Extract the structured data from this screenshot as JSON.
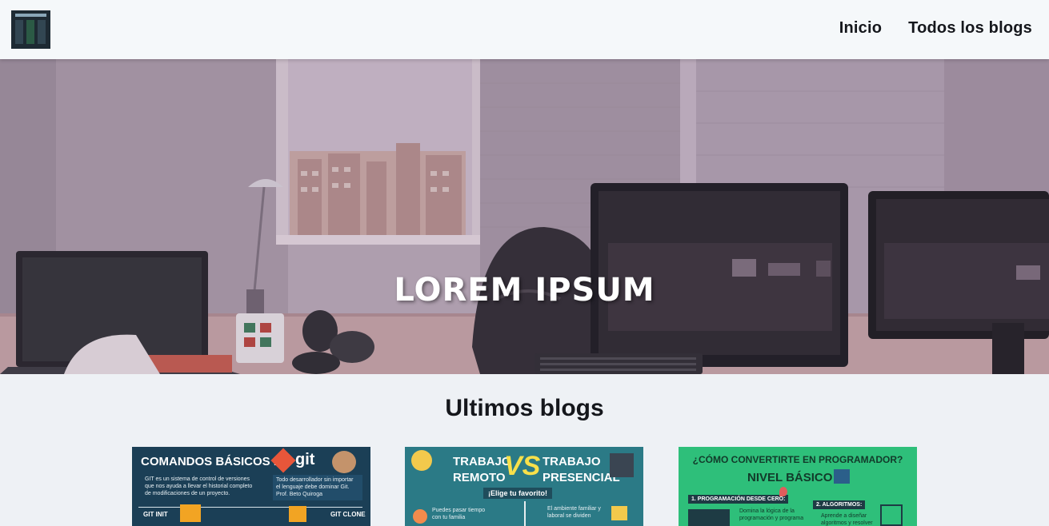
{
  "nav": {
    "links": [
      "Inicio",
      "Todos los blogs"
    ]
  },
  "hero": {
    "title": "LOREM IPSUM"
  },
  "section": {
    "title": "Ultimos blogs"
  },
  "cards": [
    {
      "title_a": "COMANDOS BÁSICOS DE",
      "title_b": "git",
      "text_left": [
        "GIT es un sistema de control de versiones",
        "que nos ayuda a llevar el historial completo",
        "de modificaciones de un proyecto."
      ],
      "text_right": [
        "Todo desarrollador sin importar",
        "el lenguaje debe dominar Git.",
        "Prof. Beto Quiroga"
      ],
      "tag_left": "GIT INIT",
      "tag_right": "GIT CLONE"
    },
    {
      "title_left": [
        "TRABAJO",
        "REMOTO"
      ],
      "vs": "VS",
      "title_right": [
        "TRABAJO",
        "PRESENCIAL"
      ],
      "banner": "¡Elige tu favorito!",
      "text_left": [
        "Puedes pasar tiempo",
        "con tu familia"
      ],
      "text_right": [
        "El ambiente familiar y",
        "laboral se dividen"
      ]
    },
    {
      "title": "¿CÓMO CONVERTIRTE EN PROGRAMADOR?",
      "subtitle": "NIVEL BÁSICO",
      "step1": "1. PROGRAMACIÓN DESDE CERO:",
      "step1_text": [
        "Domina la lógica de la",
        "programación y programa"
      ],
      "step2": "2. ALGORITMOS:",
      "step2_text": [
        "Aprende a diseñar",
        "algoritmos y resolver"
      ]
    }
  ],
  "colors": {
    "navbar_bg": "#f5f8fa",
    "page_bg": "#eef1f5",
    "hero_overlay": "#b9aab8"
  },
  "icons": [
    "logo-icon"
  ]
}
